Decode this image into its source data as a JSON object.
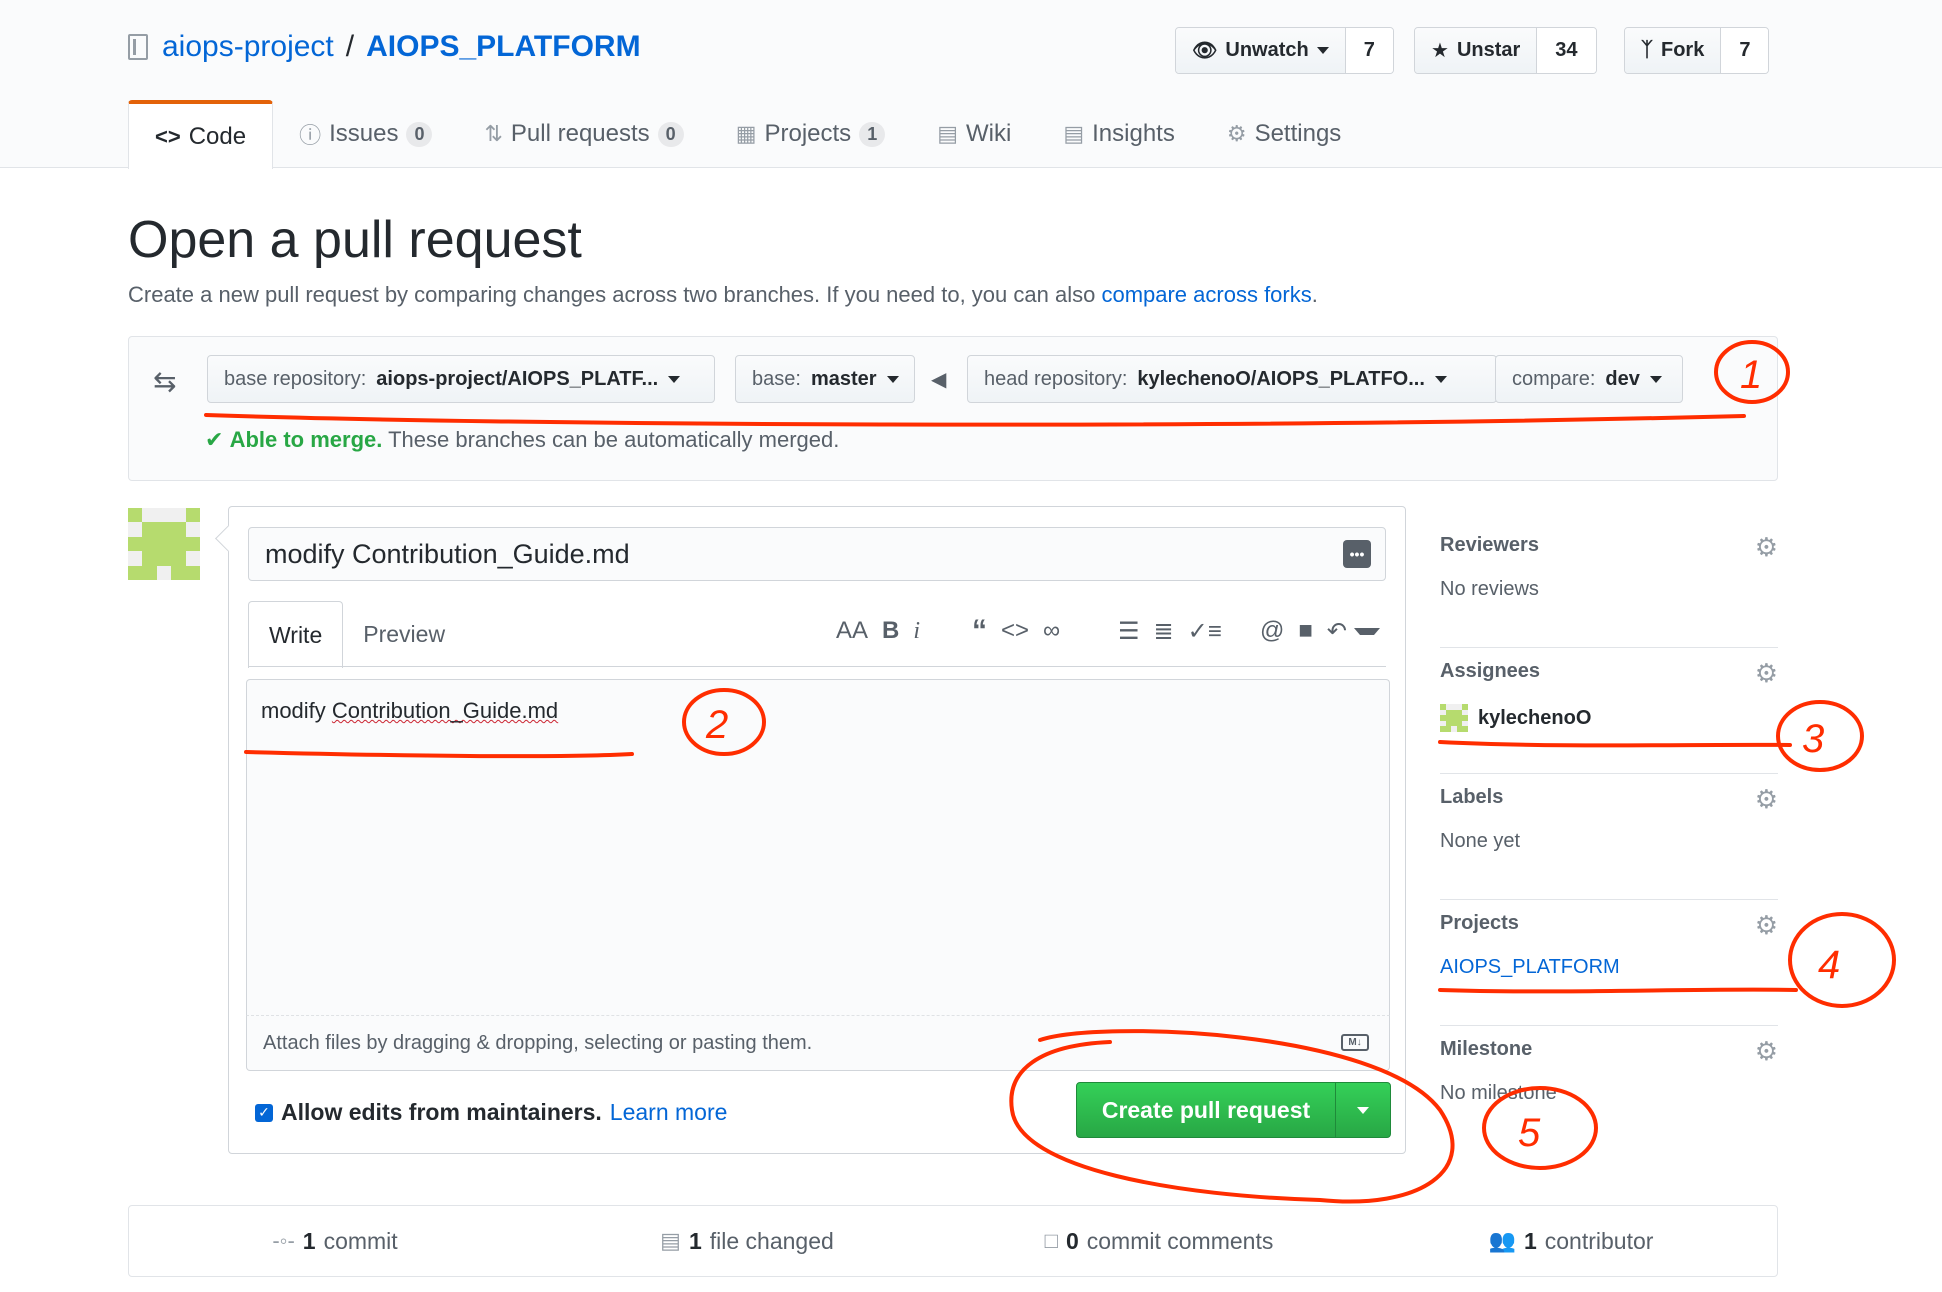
{
  "repo": {
    "owner": "aiops-project",
    "separator": "/",
    "name": "AIOPS_PLATFORM"
  },
  "actions": [
    {
      "label": "Unwatch",
      "icon": "eye-icon",
      "count": "7"
    },
    {
      "label": "Unstar",
      "icon": "star-icon",
      "count": "34"
    },
    {
      "label": "Fork",
      "icon": "fork-icon",
      "count": "7"
    }
  ],
  "tabs": [
    {
      "label": "Code",
      "icon": "code-icon",
      "counter": ""
    },
    {
      "label": "Issues",
      "icon": "issue-icon",
      "counter": "0"
    },
    {
      "label": "Pull requests",
      "icon": "pull-request-icon",
      "counter": "0"
    },
    {
      "label": "Projects",
      "icon": "project-icon",
      "counter": "1"
    },
    {
      "label": "Wiki",
      "icon": "wiki-icon",
      "counter": ""
    },
    {
      "label": "Insights",
      "icon": "graph-icon",
      "counter": ""
    },
    {
      "label": "Settings",
      "icon": "gear-icon",
      "counter": ""
    }
  ],
  "page": {
    "title": "Open a pull request",
    "subtitle_prefix": "Create a new pull request by comparing changes across two branches. If you need to, you can also ",
    "subtitle_link": "compare across forks",
    "subtitle_suffix": "."
  },
  "compare": {
    "base_repo_label": "base repository:",
    "base_repo_value": "aiops-project/AIOPS_PLATF...",
    "base_label": "base:",
    "base_value": "master",
    "head_repo_label": "head repository:",
    "head_repo_value": "kylechenoO/AIOPS_PLATFO...",
    "compare_label": "compare:",
    "compare_value": "dev",
    "merge_ok": "Able to merge.",
    "merge_text": "These branches can be automatically merged."
  },
  "composer": {
    "title_value": "modify Contribution_Guide.md",
    "write_tab": "Write",
    "preview_tab": "Preview",
    "body_prefix": "modify ",
    "body_word": "Contribution_Guide.md",
    "attach_hint": "Attach files by dragging & dropping, selecting or pasting them.",
    "allow_edits": "Allow edits from maintainers.",
    "learn_more": "Learn more",
    "create_button": "Create pull request"
  },
  "toolbar": {
    "header": "AA",
    "bold": "B",
    "italic": "i",
    "quote": "“",
    "code": "<>",
    "link": "∞",
    "ul": "☰",
    "ol": "≣",
    "task": "✓≡",
    "mention": "@",
    "ref": "■",
    "reply": "↶"
  },
  "sidebar": [
    {
      "heading": "Reviewers",
      "value": "No reviews",
      "kind": "text"
    },
    {
      "heading": "Assignees",
      "value": "kylechenoO",
      "kind": "user"
    },
    {
      "heading": "Labels",
      "value": "None yet",
      "kind": "text"
    },
    {
      "heading": "Projects",
      "value": "AIOPS_PLATFORM",
      "kind": "link"
    },
    {
      "heading": "Milestone",
      "value": "No milestone",
      "kind": "text"
    }
  ],
  "numbers": [
    {
      "count": "1",
      "label": "commit",
      "icon": "commit-icon"
    },
    {
      "count": "1",
      "label": "file changed",
      "icon": "file-diff-icon"
    },
    {
      "count": "0",
      "label": "commit comments",
      "icon": "comment-icon"
    },
    {
      "count": "1",
      "label": "contributor",
      "icon": "people-icon"
    }
  ],
  "annotations": [
    "1",
    "2",
    "3",
    "4",
    "5"
  ],
  "colors": {
    "link": "#0366d6",
    "accent_tab": "#e36209",
    "success": "#28a745",
    "annotation": "#ff2d00",
    "identicon": "#b6db6e"
  }
}
